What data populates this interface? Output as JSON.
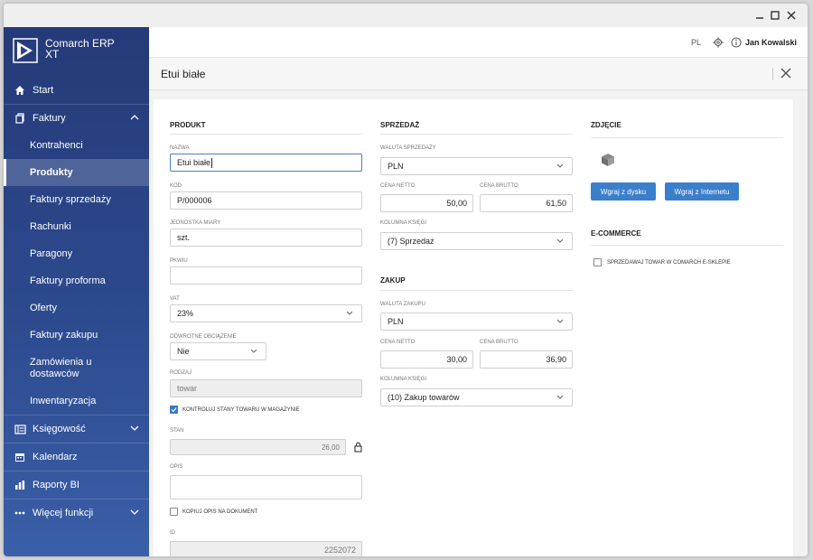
{
  "app": {
    "logo_line1": "Comarch ERP",
    "logo_line2": "XT"
  },
  "sidebar": {
    "items": [
      {
        "label": "Start"
      },
      {
        "label": "Faktury"
      },
      {
        "label": "Kontrahenci"
      },
      {
        "label": "Produkty"
      },
      {
        "label": "Faktury sprzedaży"
      },
      {
        "label": "Rachunki"
      },
      {
        "label": "Paragony"
      },
      {
        "label": "Faktury proforma"
      },
      {
        "label": "Oferty"
      },
      {
        "label": "Faktury zakupu"
      },
      {
        "label_line1": "Zamówienia u",
        "label_line2": "dostawców"
      },
      {
        "label": "Inwentaryzacja"
      },
      {
        "label": "Księgowość"
      },
      {
        "label": "Kalendarz"
      },
      {
        "label": "Raporty BI"
      },
      {
        "label": "Więcej funkcji"
      }
    ]
  },
  "topbar": {
    "lang": "PL",
    "user": "Jan Kowalski"
  },
  "header": {
    "title": "Etui białe"
  },
  "produkt": {
    "title": "PRODUKT",
    "nazwa_label": "NAZWA",
    "nazwa": "Etui białe",
    "kod_label": "KOD",
    "kod": "P/000006",
    "jm_label": "JEDNOSTKA MIARY",
    "jm": "szt.",
    "pkwiu_label": "PKWIU",
    "pkwiu": "",
    "vat_label": "VAT",
    "vat": "23%",
    "odwrotne_label": "ODWROTNE OBCIĄŻENIE",
    "odwrotne": "Nie",
    "rodzaj_label": "RODZAJ",
    "rodzaj": "towar",
    "kontroluj_label": "KONTROLUJ STANY TOWARU W MAGAZYNIE",
    "stan_label": "STAN",
    "stan": "26,00",
    "opis_label": "OPIS",
    "opis": "",
    "kopiuj_label": "KOPIUJ OPIS NA DOKUMENT",
    "id_label": "ID",
    "id": "2252072"
  },
  "sprzedaz": {
    "title": "SPRZEDAŻ",
    "waluta_label": "WALUTA SPRZEDAŻY",
    "waluta": "PLN",
    "netto_label": "CENA NETTO",
    "netto": "50,00",
    "brutto_label": "CENA BRUTTO",
    "brutto": "61,50",
    "konto_label": "KOLUMNA KSIĘGI",
    "konto": "(7) Sprzedaż"
  },
  "zakup": {
    "title": "ZAKUP",
    "waluta_label": "WALUTA ZAKUPU",
    "waluta": "PLN",
    "netto_label": "CENA NETTO",
    "netto": "30,00",
    "brutto_label": "CENA BRUTTO",
    "brutto": "36,90",
    "konto_label": "KOLUMNA KSIĘGI",
    "konto": "(10) Zakup towarów"
  },
  "zdjecie": {
    "title": "ZDJĘCIE",
    "btn_disk": "Wgraj z dysku",
    "btn_internet": "Wgraj z Internetu"
  },
  "ecommerce": {
    "title": "E-COMMERCE",
    "sell_label": "SPRZEDAWAJ TOWAR W COMARCH E-SKLEPIE"
  },
  "colors": {
    "accent": "#3b7fcc",
    "sidebar_top": "#253a78",
    "sidebar_bottom": "#3a5fa8"
  }
}
